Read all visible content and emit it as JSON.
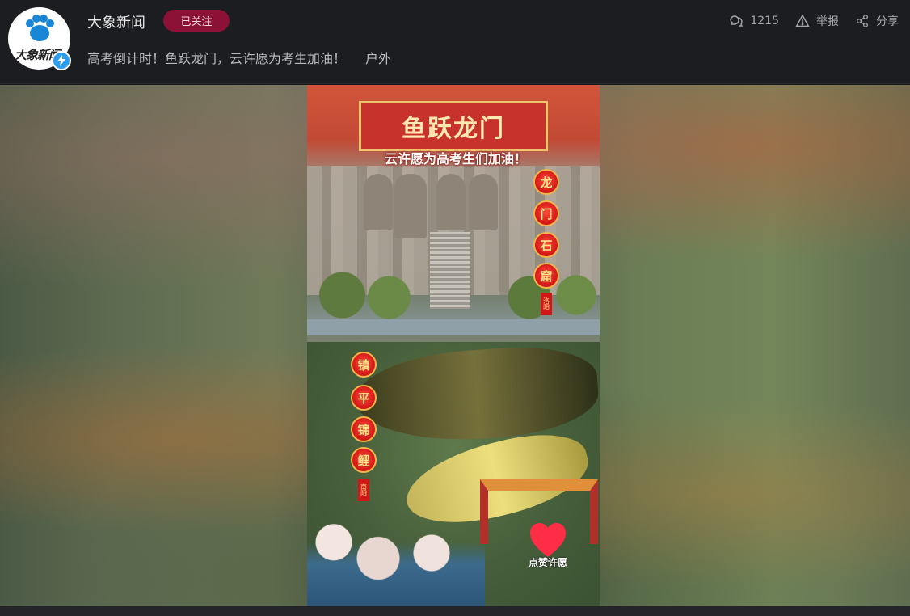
{
  "account": {
    "name": "大象新闻",
    "follow_label": "已关注",
    "logo_text": "大象新闻"
  },
  "post": {
    "title": "高考倒计时！鱼跃龙门，云许愿为考生加油！",
    "category": "户外"
  },
  "actions": {
    "comments_count": "1215",
    "report_label": "举报",
    "share_label": "分享"
  },
  "video": {
    "banner_title": "鱼跃龙门",
    "banner_subtitle": "云许愿为高考生们加油！",
    "top_lanterns": [
      "龙",
      "门",
      "石",
      "窟"
    ],
    "top_tag": "洛阳",
    "bottom_lanterns": [
      "镇",
      "平",
      "锦",
      "鲤"
    ],
    "bottom_tag": "南阳",
    "like_label": "点赞许愿"
  },
  "colors": {
    "follow_bg": "#8b1236",
    "verify_badge": "#2c9cf0",
    "lantern_red": "#d11616"
  }
}
